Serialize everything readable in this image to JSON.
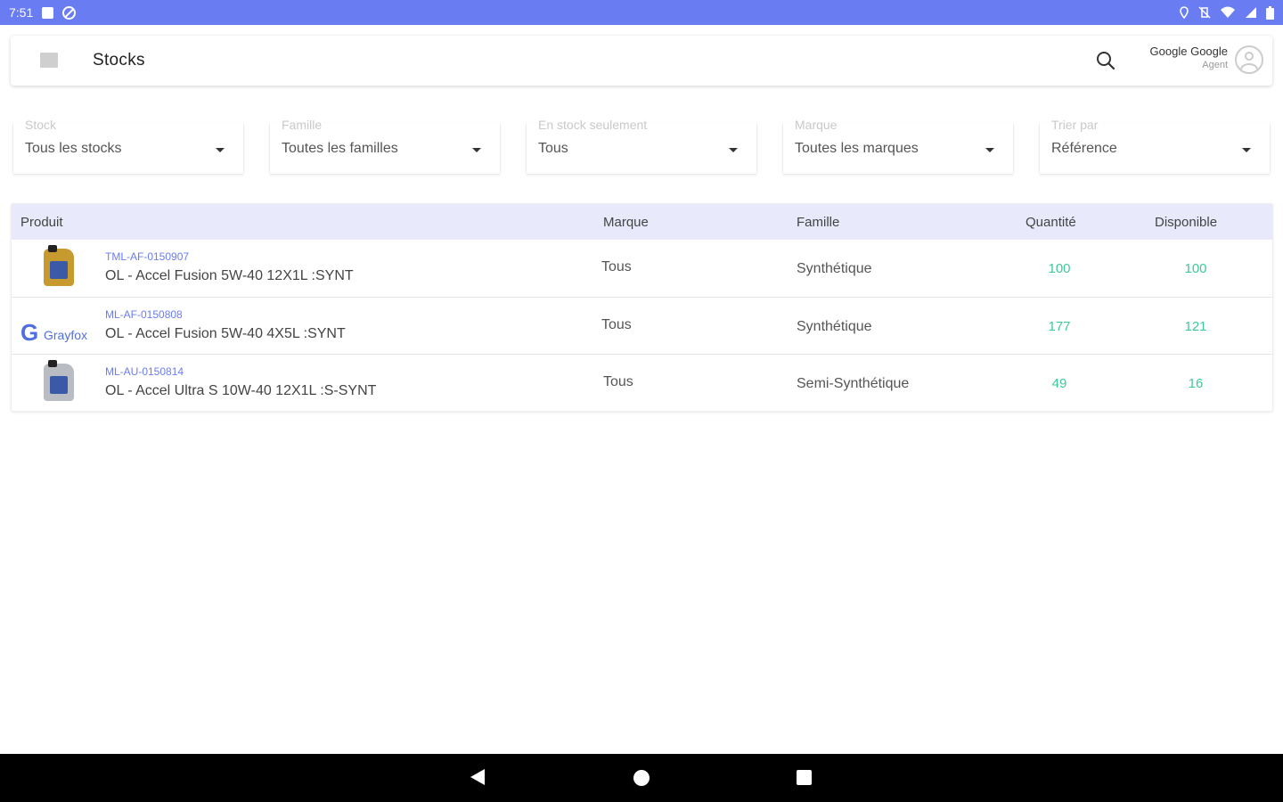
{
  "status_bar": {
    "time": "7:51"
  },
  "app_bar": {
    "title": "Stocks",
    "user_name": "Google Google",
    "user_role": "Agent"
  },
  "filters": [
    {
      "label": "Stock",
      "value": "Tous les stocks"
    },
    {
      "label": "Famille",
      "value": "Toutes les familles"
    },
    {
      "label": "En stock seulement",
      "value": "Tous"
    },
    {
      "label": "Marque",
      "value": "Toutes les marques"
    },
    {
      "label": "Trier par",
      "value": "Référence"
    }
  ],
  "table": {
    "headers": {
      "product": "Produit",
      "brand": "Marque",
      "family": "Famille",
      "quantity": "Quantité",
      "available": "Disponible"
    },
    "rows": [
      {
        "ref": "TML-AF-0150907",
        "name": "OL - Accel Fusion 5W-40 12X1L :SYNT",
        "brand": "Tous",
        "family": "Synthétique",
        "quantity": "100",
        "available": "100",
        "image": "oil-bottle-gold"
      },
      {
        "ref": "ML-AF-0150808",
        "name": "OL - Accel Fusion 5W-40 4X5L   :SYNT",
        "brand": "Tous",
        "family": "Synthétique",
        "quantity": "177",
        "available": "121",
        "image": "grayfox-logo",
        "image_text": "Grayfox"
      },
      {
        "ref": "ML-AU-0150814",
        "name": "OL - Accel Ultra S 10W-40 12X1L   :S-SYNT",
        "brand": "Tous",
        "family": "Semi-Synthétique",
        "quantity": "49",
        "available": "16",
        "image": "oil-bottle-silver"
      }
    ]
  },
  "colors": {
    "accent": "#6a7cf2",
    "header_bg": "#e8eafb",
    "quantity": "#3ec99a"
  }
}
